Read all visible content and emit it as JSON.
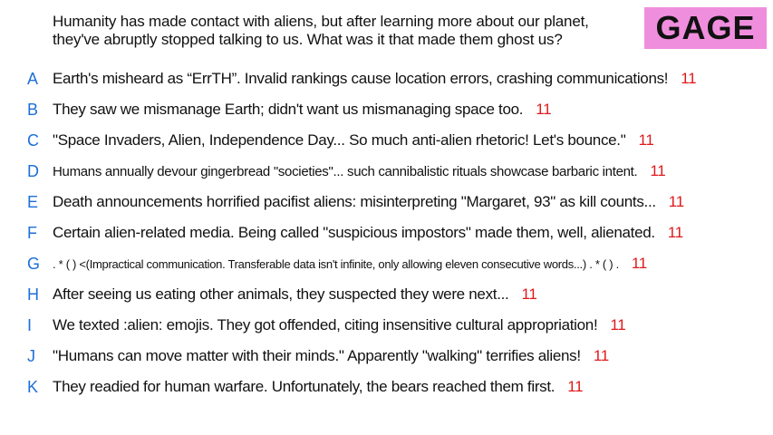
{
  "prompt": {
    "line1": "Humanity has made contact with aliens, but after learning more about our planet,",
    "line2": "they've abruptly stopped talking to us. What was it that made them ghost us?"
  },
  "player_name": "GAGE",
  "answers": [
    {
      "letter": "A",
      "text": "Earth's misheard as “ErrTH”. Invalid rankings cause location errors, crashing communications!",
      "score": "11"
    },
    {
      "letter": "B",
      "text": "They saw we mismanage Earth; didn't want us mismanaging space too.",
      "score": "11"
    },
    {
      "letter": "C",
      "text": "\"Space Invaders, Alien, Independence Day... So much anti-alien rhetoric! Let's bounce.\"",
      "score": "11"
    },
    {
      "letter": "D",
      "text": "Humans annually devour gingerbread \"societies\"... such cannibalistic rituals showcase barbaric intent.",
      "score": "11"
    },
    {
      "letter": "E",
      "text": "Death announcements horrified pacifist aliens: misinterpreting \"Margaret, 93\" as kill counts...",
      "score": "11"
    },
    {
      "letter": "F",
      "text": "Certain alien-related media. Being called \"suspicious impostors\" made them, well, alienated.",
      "score": "11"
    },
    {
      "letter": "G",
      "text": ". * ( ) <(Impractical communication. Transferable data isn't infinite, only allowing eleven consecutive words...) . * ( ) .",
      "score": "11"
    },
    {
      "letter": "H",
      "text": "After seeing us eating other animals, they suspected they were next...",
      "score": "11"
    },
    {
      "letter": "I",
      "text": "We texted :alien: emojis. They got offended, citing insensitive cultural appropriation!",
      "score": "11"
    },
    {
      "letter": "J",
      "text": "\"Humans can move matter with their minds.\" Apparently \"walking\" terrifies aliens!",
      "score": "11"
    },
    {
      "letter": "K",
      "text": "They readied for human warfare. Unfortunately, the bears reached them first.",
      "score": "11"
    }
  ]
}
